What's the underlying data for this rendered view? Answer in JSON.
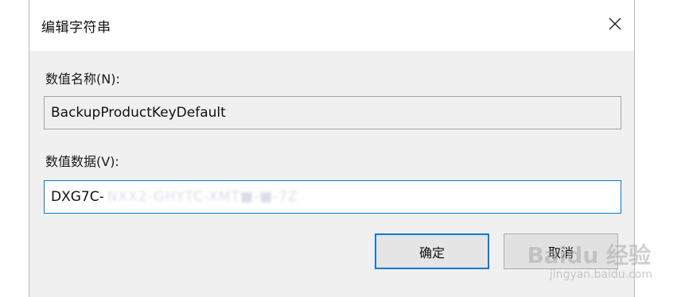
{
  "dialog": {
    "title": "编辑字符串",
    "close_icon": "close-icon"
  },
  "value_name": {
    "label": "数值名称(N):",
    "value": "BackupProductKeyDefault"
  },
  "value_data": {
    "label": "数值数据(V):",
    "visible_prefix": "DXG7C-",
    "obscured_remainder": "NXX2-GHYTC-XMT■-■-7Z"
  },
  "buttons": {
    "ok": "确定",
    "cancel": "取消"
  },
  "watermark": {
    "text": "Baidu 经验",
    "url": "jingyan.baidu.com"
  },
  "colors": {
    "accent": "#0078d7",
    "dialog_bg": "#f0f0f0"
  }
}
